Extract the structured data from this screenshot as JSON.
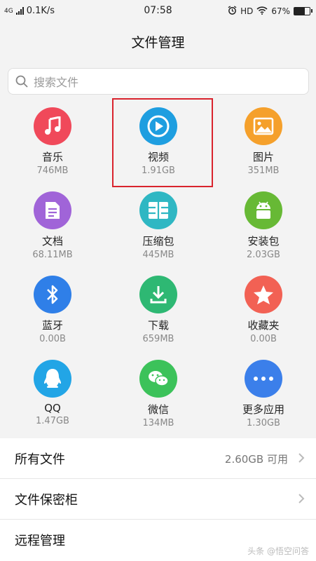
{
  "status_bar": {
    "network": "4G",
    "speed": "0.1K/s",
    "time": "07:58",
    "hd": "HD",
    "battery_percent": "67%",
    "battery_level": 0.67
  },
  "header": {
    "title": "文件管理"
  },
  "search": {
    "placeholder": "搜索文件"
  },
  "categories": [
    {
      "label": "音乐",
      "size": "746MB",
      "icon": "music-icon",
      "color": "#f0495a"
    },
    {
      "label": "视频",
      "size": "1.91GB",
      "icon": "video-play-icon",
      "color": "#1e9ee0"
    },
    {
      "label": "图片",
      "size": "351MB",
      "icon": "image-icon",
      "color": "#f5a02b"
    },
    {
      "label": "文档",
      "size": "68.11MB",
      "icon": "document-icon",
      "color": "#a064d8"
    },
    {
      "label": "压缩包",
      "size": "445MB",
      "icon": "archive-icon",
      "color": "#2fb7c3"
    },
    {
      "label": "安装包",
      "size": "2.03GB",
      "icon": "android-icon",
      "color": "#67b935"
    },
    {
      "label": "蓝牙",
      "size": "0.00B",
      "icon": "bluetooth-icon",
      "color": "#2f7fe8"
    },
    {
      "label": "下载",
      "size": "659MB",
      "icon": "download-icon",
      "color": "#2eb873"
    },
    {
      "label": "收藏夹",
      "size": "0.00B",
      "icon": "star-icon",
      "color": "#f26154"
    },
    {
      "label": "QQ",
      "size": "1.47GB",
      "icon": "qq-icon",
      "color": "#22a5e6"
    },
    {
      "label": "微信",
      "size": "134MB",
      "icon": "wechat-icon",
      "color": "#3cc25a"
    },
    {
      "label": "更多应用",
      "size": "1.30GB",
      "icon": "more-icon",
      "color": "#3b7fea"
    }
  ],
  "list": {
    "all_files": {
      "label": "所有文件",
      "value": "2.60GB 可用"
    },
    "safe": {
      "label": "文件保密柜"
    },
    "remote": {
      "label": "远程管理"
    }
  },
  "watermark": "头条 @悟空问答"
}
